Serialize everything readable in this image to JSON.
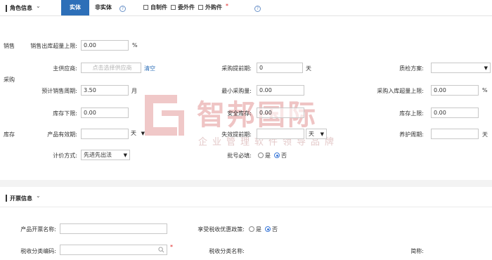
{
  "header": {
    "role_title": "角色信息",
    "tab_entity": "实体",
    "tab_non_entity": "非实体",
    "check_self_made": "自制件",
    "check_outsourced": "委外件",
    "check_purchased": "外购件",
    "required_mark": "*"
  },
  "groups": {
    "sales": "销售",
    "purchase": "采购",
    "inventory": "库存"
  },
  "sales": {
    "over_limit_label": "销售出库超量上限:",
    "over_limit_value": "0.00",
    "over_limit_unit": "%"
  },
  "purchase": {
    "supplier_label": "主供应商:",
    "supplier_placeholder": "点击选择供应商",
    "supplier_clear": "清空",
    "lead_label": "采购提前期:",
    "lead_value": "0",
    "lead_unit": "天",
    "qc_label": "质检方案:",
    "qc_value": "",
    "cycle_label": "预计销售周期:",
    "cycle_value": "3.50",
    "cycle_unit": "月",
    "min_qty_label": "最小采购量:",
    "min_qty_value": "0.00",
    "in_limit_label": "采购入库超量上限:",
    "in_limit_value": "0.00",
    "in_limit_unit": "%"
  },
  "inventory": {
    "lower_label": "库存下限:",
    "lower_value": "0.00",
    "safety_label": "安全库存:",
    "safety_value": "0.00",
    "upper_label": "库存上限:",
    "upper_value": "0.00",
    "shelf_label": "产品有效期:",
    "shelf_value": "",
    "shelf_unit": "天",
    "expiry_label": "失效提前期:",
    "expiry_value": "",
    "expiry_unit": "天",
    "maint_label": "养护周期:",
    "maint_value": "",
    "maint_unit": "天",
    "valuation_label": "计价方式:",
    "valuation_value": "先进先出法",
    "batch_label": "批号必填:",
    "yes": "是",
    "no": "否"
  },
  "invoice": {
    "title": "开票信息",
    "name_label": "产品开票名称:",
    "name_value": "",
    "tax_pref_label": "享受税收优惠政策:",
    "yes": "是",
    "no": "否",
    "tax_code_label": "税收分类编码:",
    "tax_code_value": "",
    "required_mark": "*",
    "tax_cat_label": "税收分类名称:",
    "short_label": "简称:"
  },
  "watermark": {
    "name": "智邦国际",
    "slogan": "企业管理软件领导品牌"
  },
  "colors": {
    "accent": "#2d6fb8",
    "required": "#e02020",
    "radio": "#3a78d8",
    "watermark": "#e9b9b9"
  }
}
